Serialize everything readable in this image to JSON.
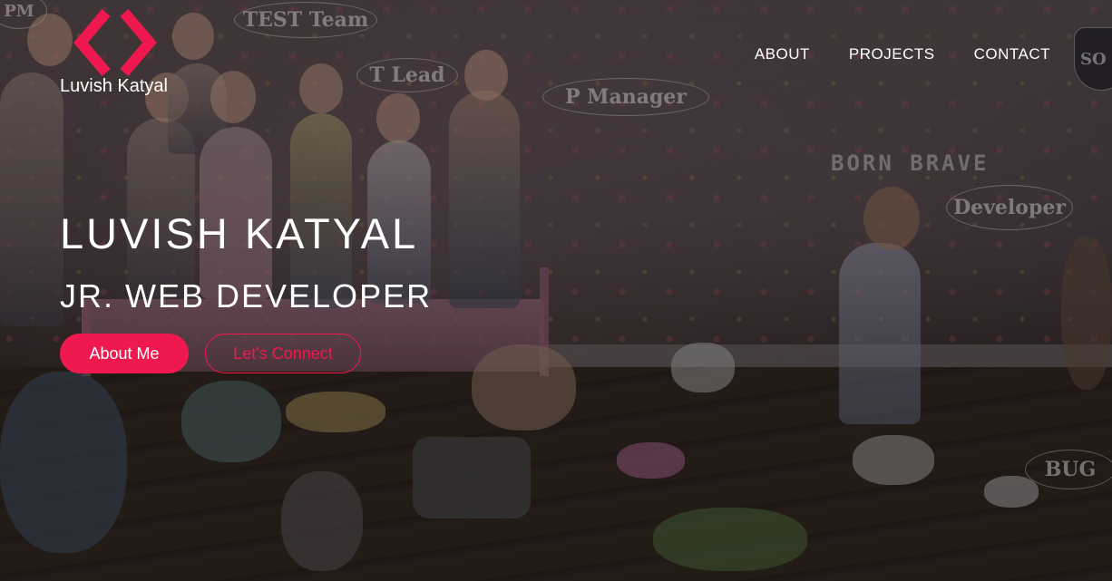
{
  "brand": {
    "logo_text": "Luvish Katyal",
    "accent_color": "#f0194f",
    "logo_icon": "code-brackets-icon"
  },
  "nav": {
    "items": [
      {
        "label": "ABOUT"
      },
      {
        "label": "PROJECTS"
      },
      {
        "label": "CONTACT"
      }
    ]
  },
  "hero": {
    "name": "LUVISH KATYAL",
    "role": "JR. WEB DEVELOPER",
    "primary_button": "About Me",
    "secondary_button": "Let's Connect"
  },
  "background": {
    "bubbles": [
      "PM",
      "TEST Team",
      "T Lead",
      "P Manager",
      "Developer",
      "BUG"
    ],
    "wall_text": "BORN BRAVE",
    "badge_text": "SO"
  }
}
